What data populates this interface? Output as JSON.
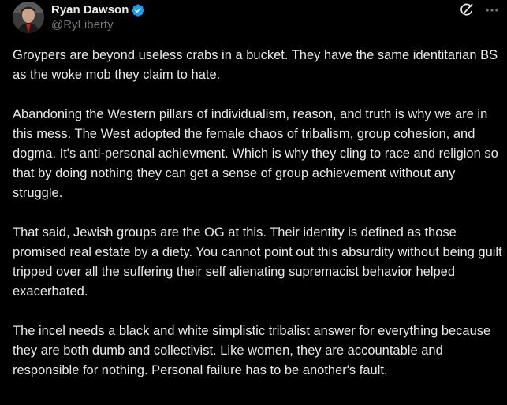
{
  "author": {
    "display_name": "Ryan Dawson",
    "handle": "@RyLiberty",
    "verified": true
  },
  "icons": {
    "verified": "verified-badge-icon",
    "grok": "grok-icon",
    "more": "more-options-icon"
  },
  "colors": {
    "background": "#000000",
    "text": "#e7e9ea",
    "secondary": "#71767b",
    "verified": "#1d9bf0"
  },
  "post": {
    "paragraphs": [
      "Groypers are beyond useless crabs in a bucket.  They have the same identitarian BS as the woke mob they claim to hate.",
      "Abandoning the Western pillars of individualism, reason, and truth is why we are in this mess.  The West adopted the female chaos of tribalism, group cohesion, and  dogma. It's  anti-personal achievment. Which is why they cling to race and religion so that by doing nothing they can get a sense of group achievement without any struggle.",
      "That said, Jewish groups are the OG at this. Their identity is defined as those promised real estate by a diety.  You cannot point out this absurdity without being guilt tripped over all the suffering their self alienating supremacist behavior helped exacerbated.",
      "The incel needs a black and white simplistic tribalist answer for everything because they are both dumb and collectivist. Like women, they are accountable and responsible for nothing. Personal failure has to be another's fault."
    ]
  }
}
